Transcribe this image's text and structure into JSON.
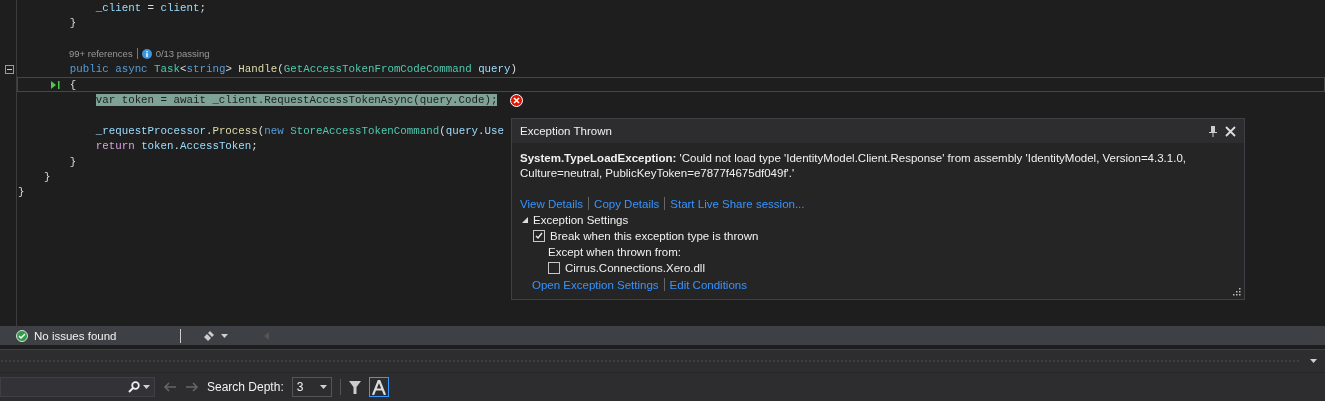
{
  "editor": {
    "lines": [
      {
        "kind": "code",
        "tokens": [
          {
            "text": "            _client",
            "kind": "ident"
          },
          {
            "text": " = ",
            "kind": "plain"
          },
          {
            "text": "client",
            "kind": "ident"
          },
          {
            "text": ";",
            "kind": "plain"
          }
        ]
      },
      {
        "kind": "code",
        "tokens": [
          {
            "text": "        }",
            "kind": "plain"
          }
        ]
      },
      {
        "kind": "blank"
      },
      {
        "kind": "codelens",
        "references": "99+ references",
        "tests": "0/13 passing"
      },
      {
        "kind": "code",
        "collapsible": true,
        "tokens": [
          {
            "text": "        public ",
            "kind": "keyword"
          },
          {
            "text": "async ",
            "kind": "keyword"
          },
          {
            "text": "Task",
            "kind": "type"
          },
          {
            "text": "<",
            "kind": "plain"
          },
          {
            "text": "string",
            "kind": "keyword"
          },
          {
            "text": "> ",
            "kind": "plain"
          },
          {
            "text": "Handle",
            "kind": "method"
          },
          {
            "text": "(",
            "kind": "plain"
          },
          {
            "text": "GetAccessTokenFromCodeCommand ",
            "kind": "type"
          },
          {
            "text": "query",
            "kind": "ident"
          },
          {
            "text": ")",
            "kind": "plain"
          }
        ]
      },
      {
        "kind": "code",
        "current": true,
        "tokens": [
          {
            "text": "        {",
            "kind": "plain"
          }
        ]
      },
      {
        "kind": "code",
        "highlighted": true,
        "error": true,
        "tokens": [
          {
            "text": "            var token = await _client.RequestAccessTokenAsync(query.Code);",
            "kind": "plain"
          }
        ]
      },
      {
        "kind": "blank"
      },
      {
        "kind": "code",
        "tokens": [
          {
            "text": "            _requestProcessor",
            "kind": "ident"
          },
          {
            "text": ".",
            "kind": "plain"
          },
          {
            "text": "Process",
            "kind": "method"
          },
          {
            "text": "(",
            "kind": "plain"
          },
          {
            "text": "new ",
            "kind": "keyword"
          },
          {
            "text": "StoreAccessTokenCommand",
            "kind": "type"
          },
          {
            "text": "(",
            "kind": "plain"
          },
          {
            "text": "query",
            "kind": "ident"
          },
          {
            "text": ".",
            "kind": "plain"
          },
          {
            "text": "Use",
            "kind": "ident"
          }
        ]
      },
      {
        "kind": "code",
        "tokens": [
          {
            "text": "            return ",
            "kind": "control"
          },
          {
            "text": "token",
            "kind": "ident"
          },
          {
            "text": ".",
            "kind": "plain"
          },
          {
            "text": "AccessToken",
            "kind": "ident"
          },
          {
            "text": ";",
            "kind": "plain"
          }
        ]
      },
      {
        "kind": "code",
        "tokens": [
          {
            "text": "        }",
            "kind": "plain"
          }
        ]
      },
      {
        "kind": "code",
        "tokens": [
          {
            "text": "    }",
            "kind": "plain"
          }
        ]
      },
      {
        "kind": "code",
        "tokens": [
          {
            "text": "}",
            "kind": "plain"
          }
        ]
      }
    ]
  },
  "exception_popup": {
    "title": "Exception Thrown",
    "message": "**System.TypeLoadException:** 'Could not load type 'IdentityModel.Client.Response' from assembly 'IdentityModel, Version=4.3.1.0, Culture=neutral, PublicKeyToken=e7877f4675df049f'.'",
    "links": [
      "View Details",
      "Copy Details",
      "Start Live Share session..."
    ],
    "settings": {
      "label": "Exception Settings",
      "expanded": true,
      "break_option": {
        "label": "Break when this exception type is thrown",
        "checked": true
      },
      "except_label": "Except when thrown from:",
      "modules": [
        {
          "label": "Cirrus.Connections.Xero.dll",
          "checked": false
        }
      ]
    },
    "footer_links": [
      "Open Exception Settings",
      "Edit Conditions"
    ]
  },
  "status_bar": {
    "issues": "No issues found"
  },
  "find_toolbar": {
    "search_depth_label": "Search Depth:",
    "search_depth": "3",
    "match_case": {
      "selected": true
    }
  }
}
